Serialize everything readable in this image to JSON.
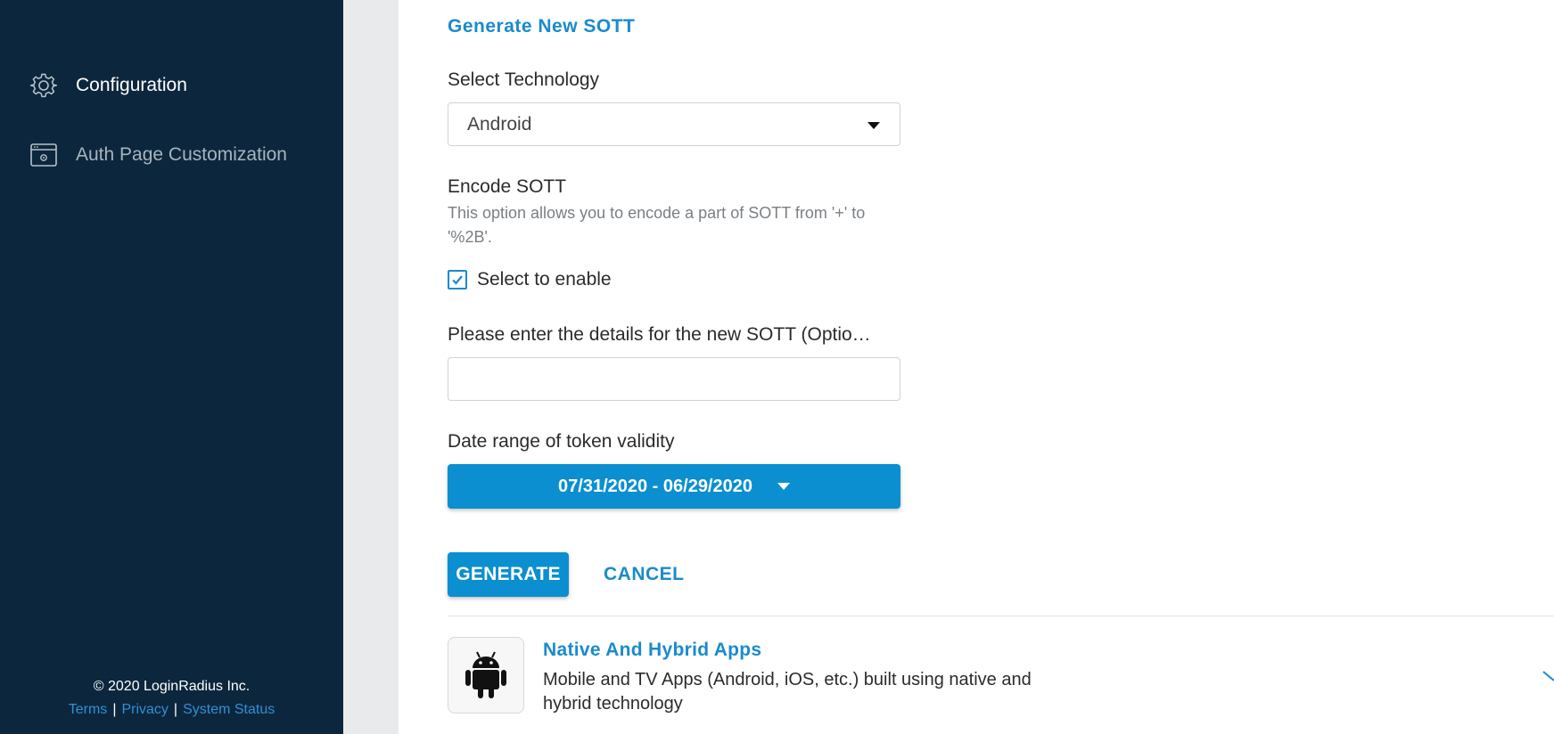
{
  "sidebar": {
    "items": [
      {
        "label": "Configuration",
        "icon": "gear-icon",
        "active": true
      },
      {
        "label": "Auth Page Customization",
        "icon": "browser-settings-icon",
        "active": false
      }
    ],
    "footer": {
      "copyright": "© 2020 LoginRadius Inc.",
      "links": [
        "Terms",
        "Privacy",
        "System Status"
      ],
      "separator": "|"
    }
  },
  "form": {
    "title": "Generate New SOTT",
    "technology": {
      "label": "Select Technology",
      "value": "Android"
    },
    "encode": {
      "label": "Encode SOTT",
      "help": "This option allows you to encode a part of SOTT from '+' to '%2B'.",
      "checkbox_label": "Select to enable",
      "checked": true
    },
    "details": {
      "label": "Please enter the details for the new SOTT (Optio…",
      "value": "",
      "placeholder": ""
    },
    "date_range": {
      "label": "Date range of token validity",
      "value": "07/31/2020 - 06/29/2020"
    },
    "actions": {
      "generate": "GENERATE",
      "cancel": "CANCEL"
    }
  },
  "app_card": {
    "icon": "android-icon",
    "title": "Native And Hybrid Apps",
    "description": "Mobile and TV Apps (Android, iOS, etc.) built using native and hybrid technology"
  },
  "colors": {
    "sidebar_bg": "#0c273d",
    "accent": "#0b8fd0",
    "link": "#2f8fd3"
  }
}
